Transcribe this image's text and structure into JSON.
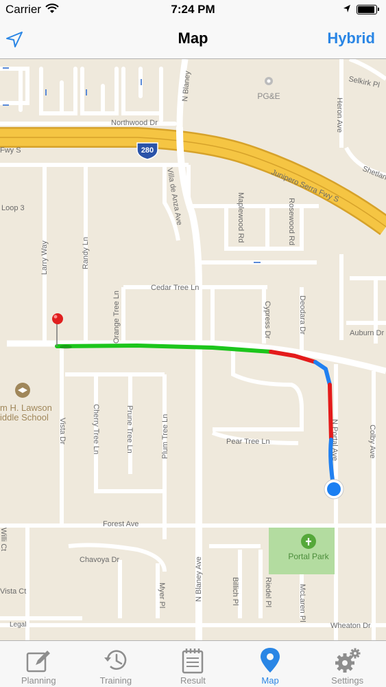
{
  "status_bar": {
    "carrier": "Carrier",
    "time": "7:24 PM"
  },
  "nav": {
    "title": "Map",
    "right_button": "Hybrid"
  },
  "map": {
    "labels": {
      "pge": "PG&E",
      "northwood": "Northwood Dr",
      "freeway": "Junipero Serra Fwy S",
      "fwy_left": "Fwy S",
      "shield": "280",
      "loop3": "Loop 3",
      "larry": "Larry Way",
      "randy": "Randy Ln",
      "villa": "Villa de Anza Ave",
      "n_blaney_top": "N Blaney",
      "maplewood": "Maplewood Rd",
      "rosewood": "Rosewood Rd",
      "heron": "Heron Ave",
      "selkirk": "Selkirk Pl",
      "shetland": "Shetlan",
      "cedar": "Cedar Tree Ln",
      "orange": "Orange Tree Ln",
      "cypress": "Cypress Dr",
      "deodara": "Deodara Dr",
      "auburn": "Auburn Dr",
      "school_1": "m H. Lawson",
      "school_2": "iddle School",
      "vista_dr": "Vista Dr",
      "cherry": "Cherry Tree Ln",
      "prune": "Prune Tree Ln",
      "plum": "Plum Tree Ln",
      "pear": "Pear Tree Ln",
      "n_portal": "N Portal Ave",
      "colby": "Colby Ave",
      "forest": "Forest Ave",
      "portal_park": "Portal Park",
      "willow": "Willi Ct",
      "chavoya": "Chavoya Dr",
      "vista_ct": "Vista Ct",
      "myer": "Myer Pl",
      "n_blaney": "N Blaney Ave",
      "billich": "Billich Pl",
      "riedel": "Riedel Pl",
      "mclaren": "McLaren Pl",
      "wheaton": "Wheaton Dr",
      "legal": "Legal"
    },
    "route_colors": {
      "fast": "#1cc51c",
      "slow": "#e41b1b",
      "medium": "#2080f0"
    },
    "road_color": "#ffffff",
    "land_color": "#efe9dc",
    "freeway_color": "#f5c543",
    "park_color": "#b3dca0"
  },
  "tabs": [
    {
      "label": "Planning",
      "icon": "pencil-note-icon"
    },
    {
      "label": "Training",
      "icon": "history-clock-icon"
    },
    {
      "label": "Result",
      "icon": "notepad-icon"
    },
    {
      "label": "Map",
      "icon": "map-pin-icon",
      "active": true
    },
    {
      "label": "Settings",
      "icon": "gears-icon"
    }
  ]
}
